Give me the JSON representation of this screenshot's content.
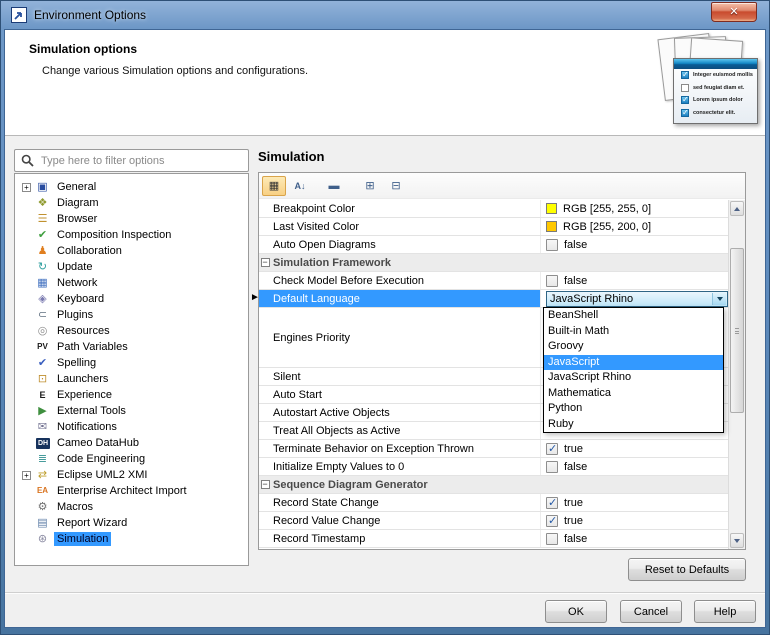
{
  "window": {
    "title": "Environment Options"
  },
  "header": {
    "title": "Simulation options",
    "description": "Change various Simulation options and configurations.",
    "graphic_checklist": [
      {
        "label": "Integer euismod mollis",
        "checked": true
      },
      {
        "label": "sed feugiat diam et.",
        "checked": false
      },
      {
        "label": "Lorem ipsum dolor",
        "checked": true
      },
      {
        "label": "consectetur elit.",
        "checked": true
      }
    ]
  },
  "sidebar": {
    "filter_placeholder": "Type here to filter options",
    "items": [
      {
        "label": "General",
        "icon": "general-icon",
        "expandable": true
      },
      {
        "label": "Diagram",
        "icon": "diagram-icon"
      },
      {
        "label": "Browser",
        "icon": "browser-icon"
      },
      {
        "label": "Composition Inspection",
        "icon": "composition-inspection-icon"
      },
      {
        "label": "Collaboration",
        "icon": "collaboration-icon"
      },
      {
        "label": "Update",
        "icon": "update-icon"
      },
      {
        "label": "Network",
        "icon": "network-icon"
      },
      {
        "label": "Keyboard",
        "icon": "keyboard-icon"
      },
      {
        "label": "Plugins",
        "icon": "plugins-icon"
      },
      {
        "label": "Resources",
        "icon": "resources-icon"
      },
      {
        "label": "Path Variables",
        "icon": "path-variables-icon"
      },
      {
        "label": "Spelling",
        "icon": "spelling-icon"
      },
      {
        "label": "Launchers",
        "icon": "launchers-icon"
      },
      {
        "label": "Experience",
        "icon": "experience-icon"
      },
      {
        "label": "External Tools",
        "icon": "external-tools-icon"
      },
      {
        "label": "Notifications",
        "icon": "notifications-icon"
      },
      {
        "label": "Cameo DataHub",
        "icon": "cameo-datahub-icon"
      },
      {
        "label": "Code Engineering",
        "icon": "code-engineering-icon"
      },
      {
        "label": "Eclipse UML2 XMI",
        "icon": "eclipse-uml2-xmi-icon",
        "expandable": true
      },
      {
        "label": "Enterprise Architect Import",
        "icon": "enterprise-architect-import-icon"
      },
      {
        "label": "Macros",
        "icon": "macros-icon"
      },
      {
        "label": "Report Wizard",
        "icon": "report-wizard-icon"
      },
      {
        "label": "Simulation",
        "icon": "simulation-icon",
        "selected": true
      }
    ]
  },
  "main": {
    "title": "Simulation",
    "toolbar": [
      {
        "name": "show-categorized-view-button",
        "glyph": "▦",
        "active": true,
        "small": false
      },
      {
        "name": "sort-alphabetically-button",
        "glyph": "A↓",
        "active": false,
        "small": true
      },
      {
        "name": "show-description-area-button",
        "glyph": "▬",
        "active": false,
        "small": false
      },
      {
        "name": "expand-all-button",
        "glyph": "⊞",
        "active": false,
        "small": false
      },
      {
        "name": "collapse-all-button",
        "glyph": "⊟",
        "active": false,
        "small": false
      }
    ],
    "rows": [
      {
        "type": "color",
        "label": "Breakpoint Color",
        "value": "RGB [255, 255, 0]",
        "swatch": "#ffff00"
      },
      {
        "type": "color",
        "label": "Last Visited Color",
        "value": "RGB [255, 200, 0]",
        "swatch": "#ffc800"
      },
      {
        "type": "bool",
        "label": "Auto Open Diagrams",
        "value": "false",
        "checked": false
      },
      {
        "type": "group",
        "label": "Simulation Framework"
      },
      {
        "type": "bool",
        "label": "Check Model Before Execution",
        "value": "false",
        "checked": false
      },
      {
        "type": "combo",
        "label": "Default Language",
        "value": "JavaScript Rhino",
        "selected": true
      },
      {
        "type": "label",
        "label": "Engines Priority",
        "h": 60
      },
      {
        "type": "label",
        "label": "Silent"
      },
      {
        "type": "label",
        "label": "Auto Start"
      },
      {
        "type": "label",
        "label": "Autostart Active Objects"
      },
      {
        "type": "label",
        "label": "Treat All Objects as Active"
      },
      {
        "type": "bool",
        "label": "Terminate Behavior on Exception Thrown",
        "value": "true",
        "checked": true
      },
      {
        "type": "bool",
        "label": "Initialize Empty Values to 0",
        "value": "false",
        "checked": false
      },
      {
        "type": "group",
        "label": "Sequence Diagram Generator"
      },
      {
        "type": "bool",
        "label": "Record State Change",
        "value": "true",
        "checked": true
      },
      {
        "type": "bool",
        "label": "Record Value Change",
        "value": "true",
        "checked": true
      },
      {
        "type": "bool",
        "label": "Record Timestamp",
        "value": "false",
        "checked": false
      }
    ],
    "dropdown": {
      "options": [
        "BeanShell",
        "Built-in Math",
        "Groovy",
        "JavaScript",
        "JavaScript Rhino",
        "Mathematica",
        "Python",
        "Ruby"
      ],
      "highlighted": "JavaScript"
    },
    "reset_label": "Reset to Defaults"
  },
  "footer": {
    "ok_label": "OK",
    "cancel_label": "Cancel",
    "help_label": "Help"
  },
  "icons": {
    "close_glyph": "✕",
    "row_marker": "►",
    "expander_plus": "+",
    "group_collapse": "−",
    "tree": {
      "general-icon": {
        "glyph": "▣",
        "color": "#2a4da0"
      },
      "diagram-icon": {
        "glyph": "❖",
        "color": "#8f9a2f"
      },
      "browser-icon": {
        "glyph": "☰",
        "color": "#c0912f"
      },
      "composition-inspection-icon": {
        "glyph": "✔",
        "color": "#3f9f3f"
      },
      "collaboration-icon": {
        "glyph": "♟",
        "color": "#e07f20"
      },
      "update-icon": {
        "glyph": "↻",
        "color": "#2f9f9f"
      },
      "network-icon": {
        "glyph": "▦",
        "color": "#3f6fbf"
      },
      "keyboard-icon": {
        "glyph": "◈",
        "color": "#7a7ab0"
      },
      "plugins-icon": {
        "glyph": "⊂",
        "color": "#607080"
      },
      "resources-icon": {
        "glyph": "◎",
        "color": "#8a8a8a"
      },
      "path-variables-icon": {
        "glyph": "PV",
        "color": "#1a1a1a",
        "font": 8,
        "bold": true
      },
      "spelling-icon": {
        "glyph": "✔",
        "color": "#3a5fbf"
      },
      "launchers-icon": {
        "glyph": "⊡",
        "color": "#bf8f2f"
      },
      "experience-icon": {
        "glyph": "E",
        "color": "#1a1a1a",
        "font": 9,
        "bold": true
      },
      "external-tools-icon": {
        "glyph": "▶",
        "color": "#3f8f3f"
      },
      "notifications-icon": {
        "glyph": "✉",
        "color": "#6f6f8f"
      },
      "cameo-datahub-icon": {
        "glyph": "DH",
        "color": "#ffffff",
        "bg": "#16325c",
        "font": 7,
        "bold": true
      },
      "code-engineering-icon": {
        "glyph": "≣",
        "color": "#2f8f8f"
      },
      "eclipse-uml2-xmi-icon": {
        "glyph": "⇄",
        "color": "#bf9f2f"
      },
      "enterprise-architect-import-icon": {
        "glyph": "EA",
        "color": "#d9731f",
        "font": 8,
        "bold": true
      },
      "macros-icon": {
        "glyph": "⚙",
        "color": "#6f6f6f"
      },
      "report-wizard-icon": {
        "glyph": "▤",
        "color": "#5f7fa7"
      },
      "simulation-icon": {
        "glyph": "⊛",
        "color": "#8888a0"
      }
    }
  },
  "colors": {
    "selection": "#3399ff",
    "toolbar_active": "#f8d084",
    "close_button_red": "#c94b2e"
  }
}
